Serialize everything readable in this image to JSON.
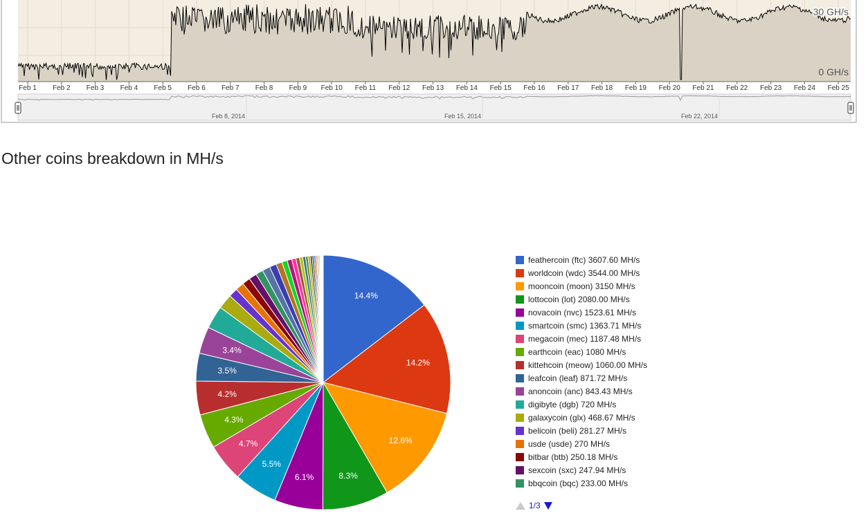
{
  "section_title": "Other coins breakdown in MH/s",
  "hashrate_chart": {
    "y_labels": [
      "30 GH/s",
      "0 GH/s"
    ],
    "x_ticks": [
      "Feb 1",
      "Feb 2",
      "Feb 3",
      "Feb 4",
      "Feb 5",
      "Feb 6",
      "Feb 7",
      "Feb 8",
      "Feb 9",
      "Feb 10",
      "Feb 11",
      "Feb 12",
      "Feb 13",
      "Feb 14",
      "Feb 15",
      "Feb 16",
      "Feb 17",
      "Feb 18",
      "Feb 19",
      "Feb 20",
      "Feb 21",
      "Feb 22",
      "Feb 23",
      "Feb 24",
      "Feb 25"
    ],
    "navigator_labels": [
      "Feb 8, 2014",
      "Feb 15, 2014",
      "Feb 22, 2014"
    ],
    "colors": {
      "plot_bg": "#f3ede2",
      "area_fill": "#d9d2c5",
      "line": "#000000"
    }
  },
  "chart_data": {
    "type": "pie",
    "title": "Other coins breakdown in MH/s",
    "slice_labels": [
      "14.4%",
      "14.2%",
      "12.6%",
      "8.3%",
      "6.1%",
      "5.5%",
      "4.7%",
      "4.3%",
      "4.2%",
      "3.5%",
      "3.4%"
    ],
    "series": [
      {
        "name": "feathercoin (ftc) 3607.60 MH/s",
        "value": 3607.6,
        "color": "#3366cc"
      },
      {
        "name": "worldcoin (wdc) 3544.00 MH/s",
        "value": 3544.0,
        "color": "#dc3912"
      },
      {
        "name": "mooncoin (moon) 3150 MH/s",
        "value": 3150,
        "color": "#ff9900"
      },
      {
        "name": "lottocoin (lot) 2080.00 MH/s",
        "value": 2080.0,
        "color": "#109618"
      },
      {
        "name": "novacoin (nvc) 1523.61 MH/s",
        "value": 1523.61,
        "color": "#990099"
      },
      {
        "name": "smartcoin (smc) 1363.71 MH/s",
        "value": 1363.71,
        "color": "#0099c6"
      },
      {
        "name": "megacoin (mec) 1187.48 MH/s",
        "value": 1187.48,
        "color": "#dd4477"
      },
      {
        "name": "earthcoin (eac) 1080 MH/s",
        "value": 1080,
        "color": "#66aa00"
      },
      {
        "name": "kittehcoin (meow) 1060.00 MH/s",
        "value": 1060.0,
        "color": "#b82e2e"
      },
      {
        "name": "leafcoin (leaf) 871.72 MH/s",
        "value": 871.72,
        "color": "#316395"
      },
      {
        "name": "anoncoin (anc) 843.43 MH/s",
        "value": 843.43,
        "color": "#994499"
      },
      {
        "name": "digibyte (dgb) 720 MH/s",
        "value": 720,
        "color": "#22aa99"
      },
      {
        "name": "galaxycoin (glx) 468.67 MH/s",
        "value": 468.67,
        "color": "#aaaa11"
      },
      {
        "name": "belicoin (beli) 281.27 MH/s",
        "value": 281.27,
        "color": "#6633cc"
      },
      {
        "name": "usde (usde) 270 MH/s",
        "value": 270,
        "color": "#e67300"
      },
      {
        "name": "bitbar (btb) 250.18 MH/s",
        "value": 250.18,
        "color": "#8b0707"
      },
      {
        "name": "sexcoin (sxc) 247.94 MH/s",
        "value": 247.94,
        "color": "#651067"
      },
      {
        "name": "bbqcoin (bqc) 233.00 MH/s",
        "value": 233.0,
        "color": "#329262"
      }
    ],
    "other_slice_colors": [
      "#5574a6",
      "#3b3eac",
      "#b77322",
      "#16d620",
      "#b91383",
      "#f4359e",
      "#9c5935",
      "#a9c413",
      "#2a778d",
      "#668d1c",
      "#bea413",
      "#0c5922",
      "#743411",
      "#3366cc",
      "#dc3912",
      "#ff9900",
      "#109618",
      "#990099",
      "#0099c6",
      "#dd4477",
      "#66aa00",
      "#b82e2e",
      "#316395",
      "#994499"
    ],
    "other_slices_total_percent": 7.9,
    "legend_position": "right",
    "pager": {
      "label": "1/3"
    }
  }
}
